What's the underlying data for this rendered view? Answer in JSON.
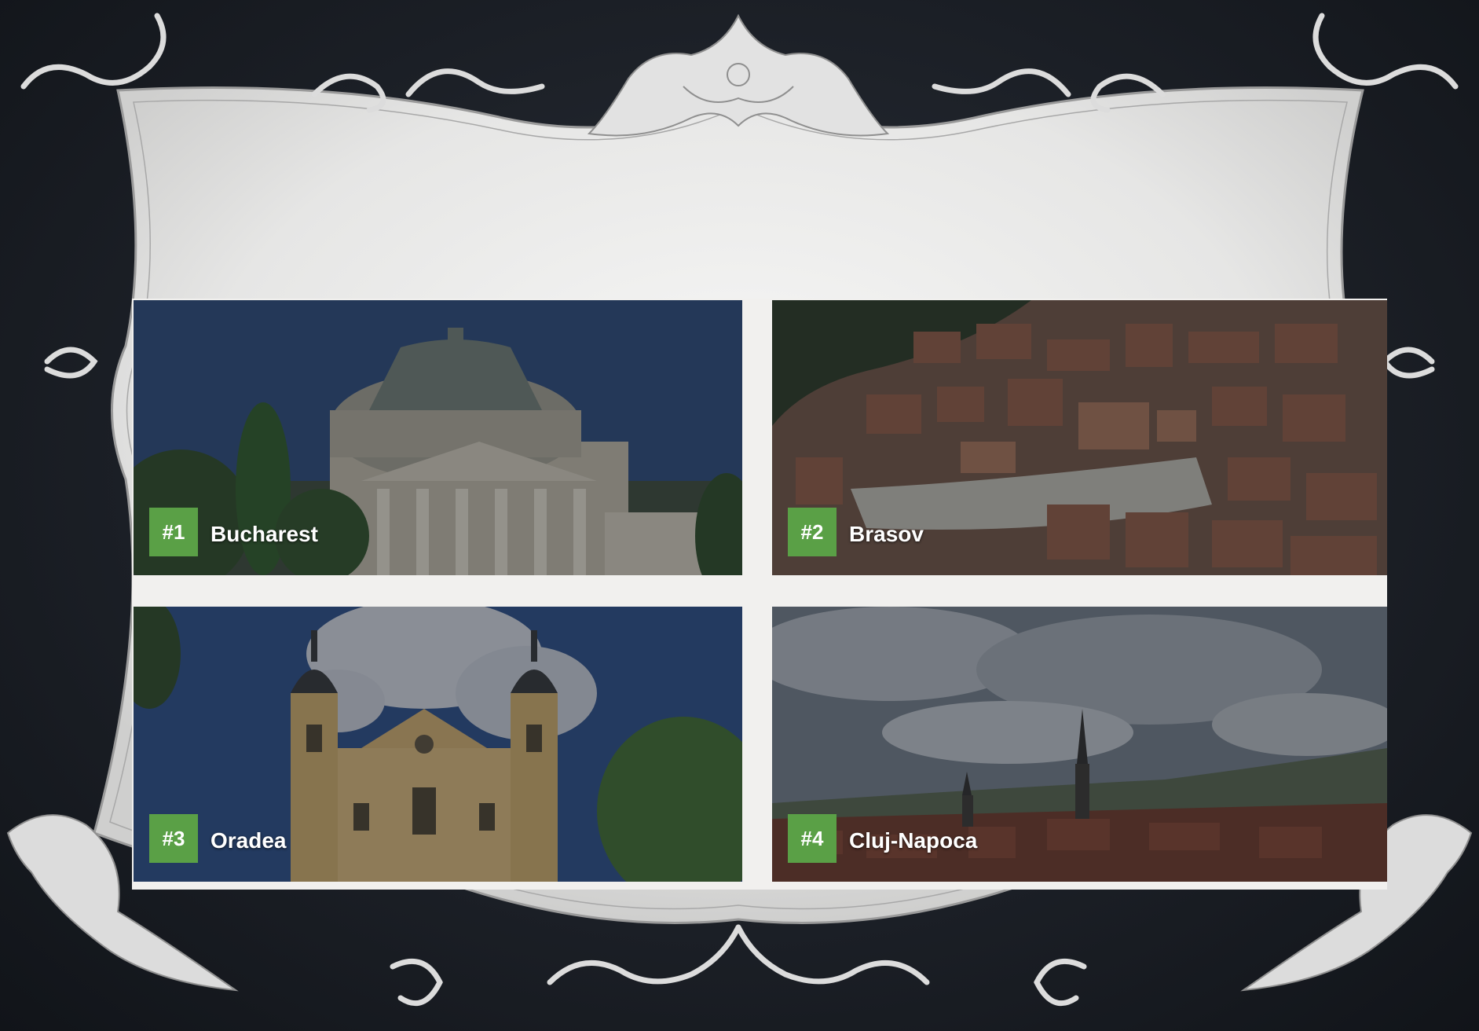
{
  "colors": {
    "background": "#1c2027",
    "frame": "#ebebea",
    "ornament": "#d9d9d9",
    "badge": "#5aa046",
    "label": "#ffffff"
  },
  "frame": {
    "style": "ornate-scroll-border",
    "icon": "ornament-icon"
  },
  "tiles": [
    {
      "rank": "#1",
      "city": "Bucharest",
      "scene": "domed-neoclassical-building"
    },
    {
      "rank": "#2",
      "city": "Brasov",
      "scene": "aerial-old-town-rooftops"
    },
    {
      "rank": "#3",
      "city": "Oradea",
      "scene": "baroque-cathedral-twin-towers"
    },
    {
      "rank": "#4",
      "city": "Cluj-Napoca",
      "scene": "city-panorama-cloudy-sky"
    }
  ]
}
